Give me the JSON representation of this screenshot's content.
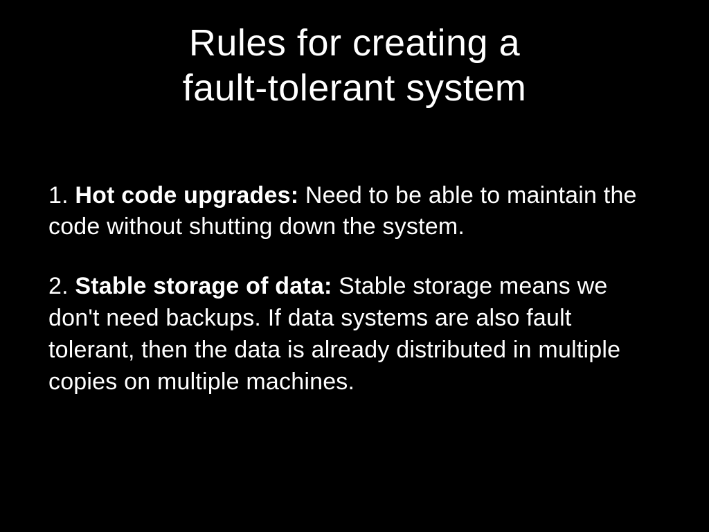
{
  "title_line1": "Rules for creating a",
  "title_line2": "fault-tolerant system",
  "rules": [
    {
      "num": "1. ",
      "label": "Hot code upgrades:",
      "desc": " Need to be able to maintain the code without shutting down the system."
    },
    {
      "num": "2. ",
      "label": "Stable storage of data:",
      "desc": " Stable storage means we don't need backups. If data systems are also fault tolerant, then the data is already distributed in multiple copies on multiple machines."
    }
  ]
}
